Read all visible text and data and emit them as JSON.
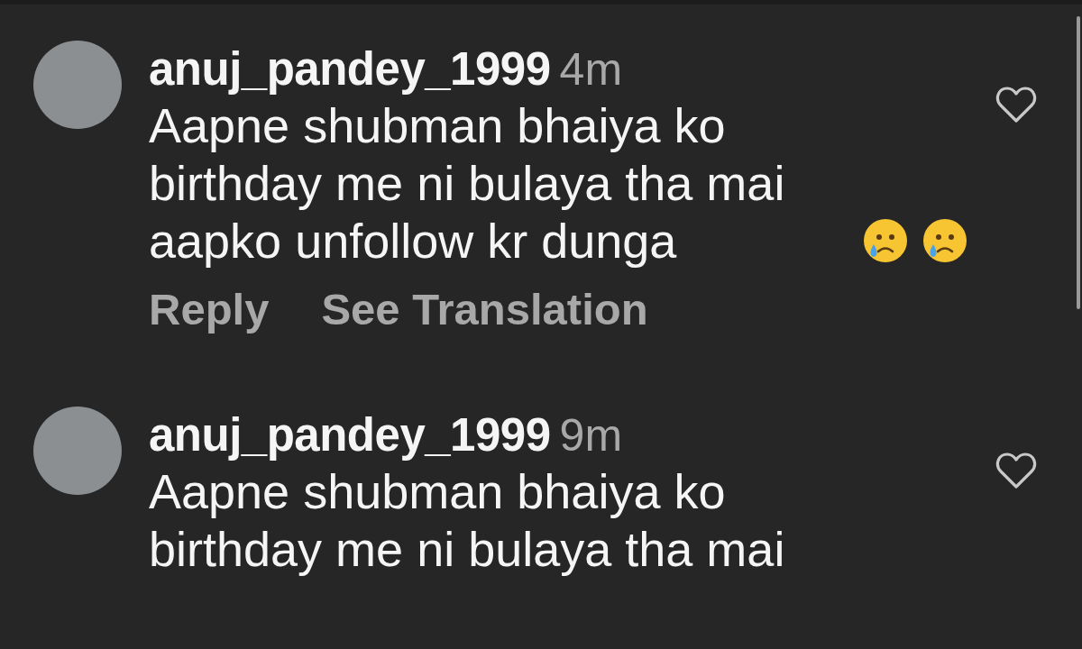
{
  "comments": [
    {
      "username": "anuj_pandey_1999",
      "time": "4m",
      "text": "Aapne shubman bhaiya ko birthday me ni bulaya tha mai aapko unfollow kr dunga",
      "emojis": [
        {
          "kind": "crying"
        },
        {
          "kind": "crying"
        }
      ],
      "liked": false,
      "actions": [
        "Reply",
        "See Translation"
      ]
    },
    {
      "username": "anuj_pandey_1999",
      "time": "9m",
      "text": "Aapne shubman bhaiya ko birthday me ni bulaya tha mai",
      "liked": false
    }
  ]
}
